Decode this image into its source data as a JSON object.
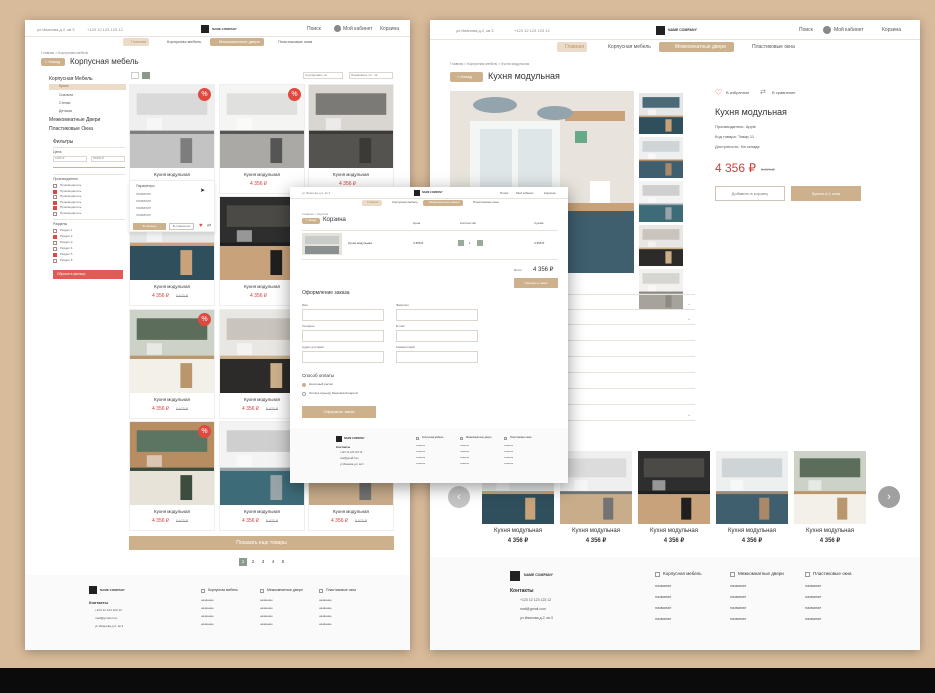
{
  "brand": {
    "name": "NAME COMPANY"
  },
  "header": {
    "address": "ул.Иванова,д.2, кв.3",
    "phone": "+123 12 123 123 12",
    "search": "Поиск",
    "account": "Мой кабинет",
    "cart": "Корзина"
  },
  "nav": {
    "home": "Главная",
    "cabinet": "Корпусная мебель",
    "doors": "Межкомнатные двери",
    "windows": "Пластиковые окна"
  },
  "catalog": {
    "breadcrumb": "Главная  >  Корпусная мебель",
    "back": "< Назад",
    "title": "Корпусная мебель",
    "sort": "Сортировать по",
    "show": "Показывать по : 12",
    "sidebar": {
      "cabinet": "Корпусная Мебель",
      "sub": [
        "Кухни",
        "Спальни",
        "Стенки",
        "Детская"
      ],
      "doors": "Межкомнатные Двери",
      "windows": "Пластиковые Окна"
    },
    "filters": {
      "title": "Фильтры",
      "price": "Цена",
      "price_from": "1000 ₽",
      "price_to": "90000 ₽",
      "maker": "Производитель",
      "makers": [
        "Производитель",
        "Производитель",
        "Производитель",
        "Производитель",
        "Производитель",
        "Производитель"
      ],
      "section": "Разделы",
      "sections": [
        "Раздел 1",
        "Раздел 2",
        "Раздел 3",
        "Раздел 4",
        "Раздел 5",
        "Раздел 6"
      ],
      "reset": "Сбросить фильтр"
    },
    "products": [
      {
        "name": "Кухня модульная",
        "price": "4 356 ₽",
        "old": "5 670 ₽"
      },
      {
        "name": "Кухня модульная",
        "price": "4 356 ₽",
        "old": ""
      },
      {
        "name": "Кухня модульная",
        "price": "4 356 ₽",
        "old": ""
      },
      {
        "name": "Кухня модульная",
        "price": "4 356 ₽",
        "old": "5 670 ₽"
      },
      {
        "name": "Кухня модульная",
        "price": "4 356 ₽",
        "old": ""
      },
      {
        "name": "Кухня модульная",
        "price": "4 356 ₽",
        "old": ""
      },
      {
        "name": "Кухня модульная",
        "price": "4 356 ₽",
        "old": "5 670 ₽"
      },
      {
        "name": "Кухня модульная",
        "price": "4 356 ₽",
        "old": "5 670 ₽"
      },
      {
        "name": "Кухня модульная",
        "price": "4 356 ₽",
        "old": ""
      },
      {
        "name": "Кухня модульная",
        "price": "4 356 ₽",
        "old": "5 670 ₽"
      },
      {
        "name": "Кухня модульная",
        "price": "4 356 ₽",
        "old": "5 670 ₽"
      },
      {
        "name": "Кухня модульная",
        "price": "4 356 ₽",
        "old": "5 670 ₽"
      }
    ],
    "hover_params": {
      "title": "Параметры",
      "rows": [
        "название",
        "название",
        "название",
        "название",
        "название"
      ],
      "cart": "В корзину",
      "compare": "В сравнение"
    },
    "load_more": "Показать еще товары",
    "pages": [
      "1",
      "2",
      "3",
      "4",
      "5"
    ]
  },
  "footer": {
    "contacts": "Контакты",
    "phone": "+123 12 123 123 12",
    "email": "mail@gmail.com",
    "address": "ул.Иванова,д.2, кв.3",
    "cols": [
      "Корпусная мебель",
      "Межкомнатные двери",
      "Пластиковые окна"
    ],
    "item": "название"
  },
  "product": {
    "breadcrumb": "Главная  >  Корпусная мебель  >  Кухня модульная",
    "back": "< Назад",
    "title": "Кухня модульная",
    "fav": "В избранное",
    "compare": "В сравнение",
    "name": "Кухня модульная",
    "maker": "Производитель: Apple",
    "code": "Код товара: Товар 11",
    "avail": "Доступность: На складе",
    "price": "4 356 ₽",
    "old": "5 670 ₽",
    "add": "Добавить в корзину",
    "buy": "Купить в 1 клик",
    "related": [
      {
        "name": "Кухня модульная",
        "price": "4 356 ₽"
      },
      {
        "name": "Кухня модульная",
        "price": "4 356 ₽"
      },
      {
        "name": "Кухня модульная",
        "price": "4 356 ₽"
      },
      {
        "name": "Кухня модульная",
        "price": "4 356 ₽"
      },
      {
        "name": "Кухня модульная",
        "price": "4 356 ₽"
      }
    ]
  },
  "cart": {
    "breadcrumb": "Главная  >  Корзина",
    "back": "< Назад",
    "title": "Корзина",
    "col_price": "Цена",
    "col_qty": "Количество",
    "col_sum": "Сумма",
    "item_name": "Кухня модульная",
    "item_price": "4 356 ₽",
    "item_qty": "1",
    "item_sum": "4 356 ₽",
    "total_label": "Итого",
    "total": "4 356 ₽",
    "checkout": "Оформить заказ",
    "form_title": "Оформление заказа",
    "fields": [
      "Имя",
      "Фамилия",
      "Телефон",
      "E-mail",
      "Адрес доставки",
      "Комментарий"
    ],
    "pay_title": "Способ оплаты",
    "pay1": "Наличный расчет",
    "pay2": "Оплата курьеру банковской картой",
    "submit": "Оформить заказ"
  },
  "colors": {
    "accent": "#cdb08c",
    "accent_light": "#eadcc8",
    "sale": "#e0493f",
    "bg": "#d8bb9a"
  }
}
